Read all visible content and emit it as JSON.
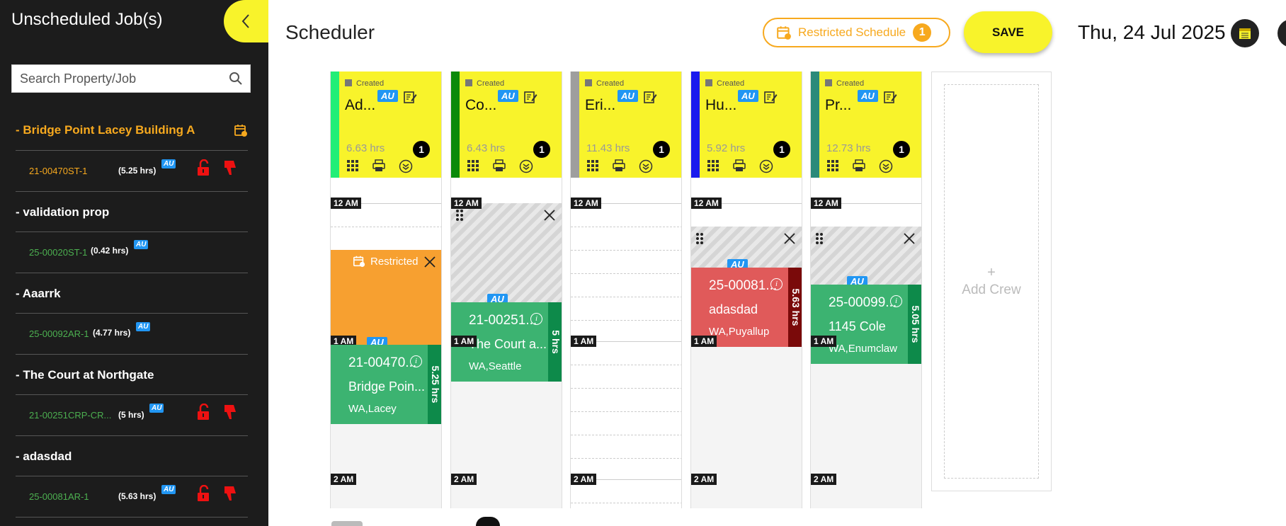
{
  "sidebar": {
    "title": "Unscheduled Job(s)",
    "search_placeholder": "Search Property/Job",
    "groups": [
      {
        "name": "- Bridge Point Lacey Building A",
        "job_id": "21-00470ST-1",
        "hours": "(5.25 hrs)",
        "tag": "AU"
      },
      {
        "name": "- validation prop",
        "job_id": "25-00020ST-1",
        "hours": "(0.42 hrs)",
        "tag": "AU"
      },
      {
        "name": "- Aaarrk",
        "job_id": "25-00092AR-1",
        "hours": "(4.77 hrs)",
        "tag": "AU"
      },
      {
        "name": "- The Court at Northgate",
        "job_id": "21-00251CRP-CR...",
        "hours": "(5 hrs)",
        "tag": "AU"
      },
      {
        "name": "- adasdad",
        "job_id": "25-00081AR-1",
        "hours": "(5.63 hrs)",
        "tag": "AU"
      }
    ]
  },
  "header": {
    "title": "Scheduler",
    "restricted_label": "Restricted Schedule",
    "restricted_count": "1",
    "save_label": "SAVE",
    "date": "Thu, 24 Jul 2025"
  },
  "colors": {
    "accent": "#f8f32b",
    "warning": "#f7a91e",
    "success": "#3cb371",
    "danger": "#e05a5a"
  },
  "time_labels": [
    "12 AM",
    "1 AM",
    "2 AM"
  ],
  "crews": [
    {
      "status": "Created",
      "name": "Ad...",
      "tag": "AU",
      "hours": "6.63 hrs",
      "count": "1",
      "color": "#22ee77",
      "restricted_label": "Restricted",
      "job": {
        "tag": "AU",
        "id": "21-00470...",
        "property": "Bridge Poin...",
        "location": "WA,Lacey",
        "duration": "5.25 hrs"
      }
    },
    {
      "status": "Created",
      "name": "Co...",
      "tag": "AU",
      "hours": "6.43 hrs",
      "count": "1",
      "color": "#0a8a0a",
      "job": {
        "tag": "AU",
        "id": "21-00251...",
        "property": "The Court a...",
        "location": "WA,Seattle",
        "duration": "5 hrs"
      }
    },
    {
      "status": "Created",
      "name": "Eri...",
      "tag": "AU",
      "hours": "11.43 hrs",
      "count": "1",
      "color": "#9e9e9e"
    },
    {
      "status": "Created",
      "name": "Hu...",
      "tag": "AU",
      "hours": "5.92 hrs",
      "count": "1",
      "color": "#1a1aee",
      "job": {
        "tag": "AU",
        "id": "25-00081...",
        "property": "adasdad",
        "location": "WA,Puyallup",
        "duration": "5.63 hrs"
      }
    },
    {
      "status": "Created",
      "name": "Pr...",
      "tag": "AU",
      "hours": "12.73 hrs",
      "count": "1",
      "color": "#2a8a7a",
      "job": {
        "tag": "AU",
        "id": "25-00099...",
        "property": "1145 Cole",
        "location": "WA,Enumclaw",
        "duration": "5.05 hrs"
      }
    }
  ],
  "add_crew": {
    "plus": "+",
    "label": "Add Crew"
  }
}
